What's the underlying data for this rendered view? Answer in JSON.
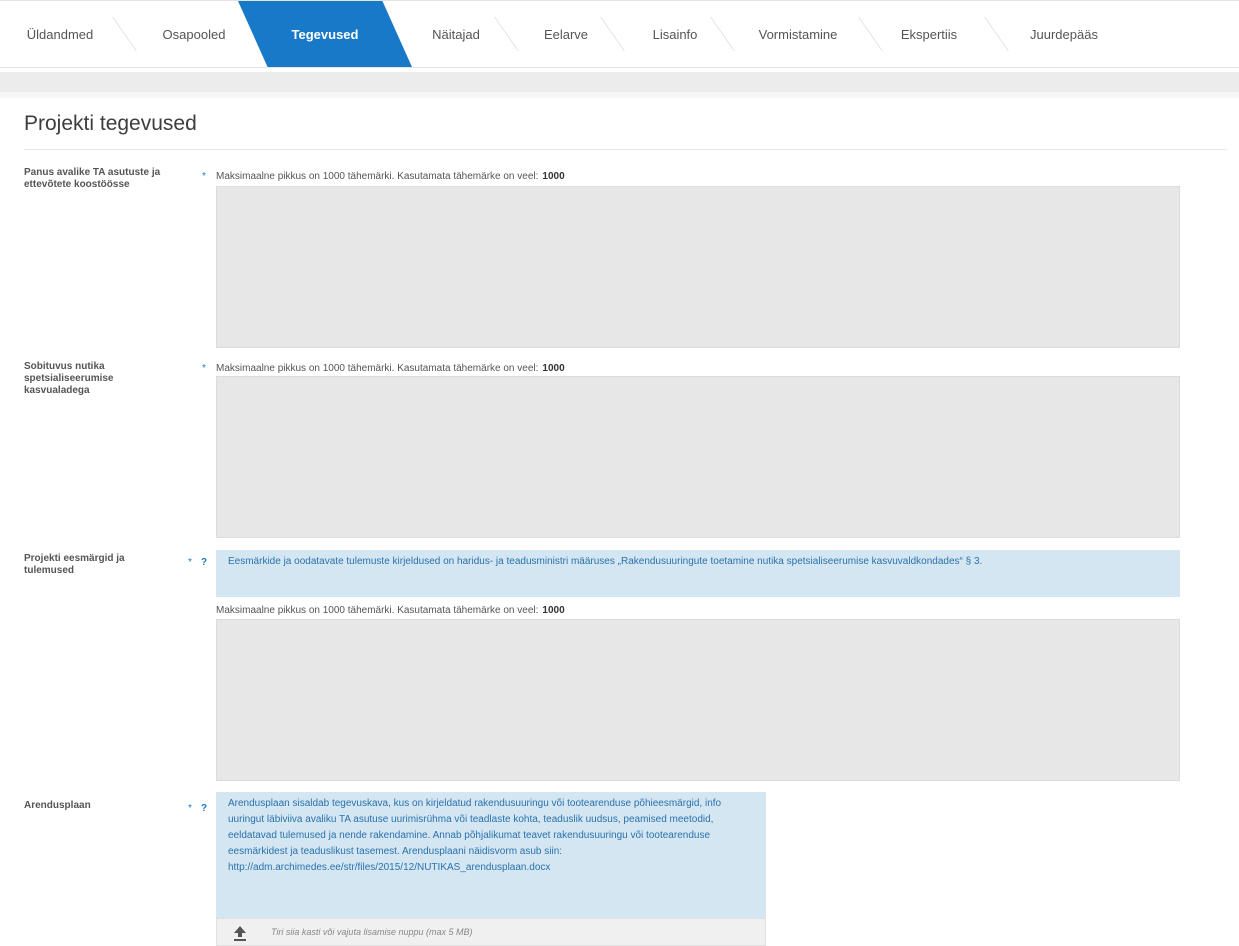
{
  "tabs": [
    {
      "label": "Üldandmed",
      "active": false
    },
    {
      "label": "Osapooled",
      "active": false
    },
    {
      "label": "Tegevused",
      "active": true
    },
    {
      "label": "Näitajad",
      "active": false
    },
    {
      "label": "Eelarve",
      "active": false
    },
    {
      "label": "Lisainfo",
      "active": false
    },
    {
      "label": "Vormistamine",
      "active": false
    },
    {
      "label": "Ekspertiis",
      "active": false
    },
    {
      "label": "Juurdepääs",
      "active": false
    }
  ],
  "page_title": "Projekti tegevused",
  "counter_text": "Maksimaalne pikkus on 1000 tähemärki. Kasutamata tähemärke on veel:",
  "counter_value": "1000",
  "required_marker": "*",
  "help_marker": "?",
  "fields": [
    {
      "label": "Panus avalike TA asutuste ja ettevõtete koostöösse",
      "value": ""
    },
    {
      "label": "Sobituvus nutika spetsialiseerumise kasvualadega",
      "value": ""
    },
    {
      "label": "Projekti eesmärgid ja tulemused",
      "help": "Eesmärkide ja oodatavate tulemuste kirjeldused on haridus- ja teadusministri määruses „Rakendusuuringute toetamine nutika spetsialiseerumise kasvuvaldkondades“ § 3.",
      "value": ""
    },
    {
      "label": "Arendusplaan",
      "help": "Arendusplaan sisaldab tegevuskava, kus on kirjeldatud rakendusuuringu või tootearenduse põhieesmärgid, info uuringut läbiviiva avaliku TA asutuse uurimisrühma või teadlaste kohta, teaduslik uudsus, peamised meetodid, eeldatavad tulemused ja nende rakendamine. Annab põhjalikumat teavet rakendusuuringu või tootearenduse eesmärkidest ja teaduslikust tasemest. Arendusplaani näidisvorm asub siin: http://adm.archimedes.ee/str/files/2015/12/NUTIKAS_arendusplaan.docx",
      "upload_hint": "Tiri siia kasti või vajuta lisamise nuppu (max 5 MB)"
    }
  ],
  "colors": {
    "accent": "#1879c9",
    "textarea_bg": "#e7e7e7",
    "info_bg": "#d3e6f2",
    "info_text": "#2a72ad"
  },
  "icons": {
    "upload": "upload-icon"
  }
}
